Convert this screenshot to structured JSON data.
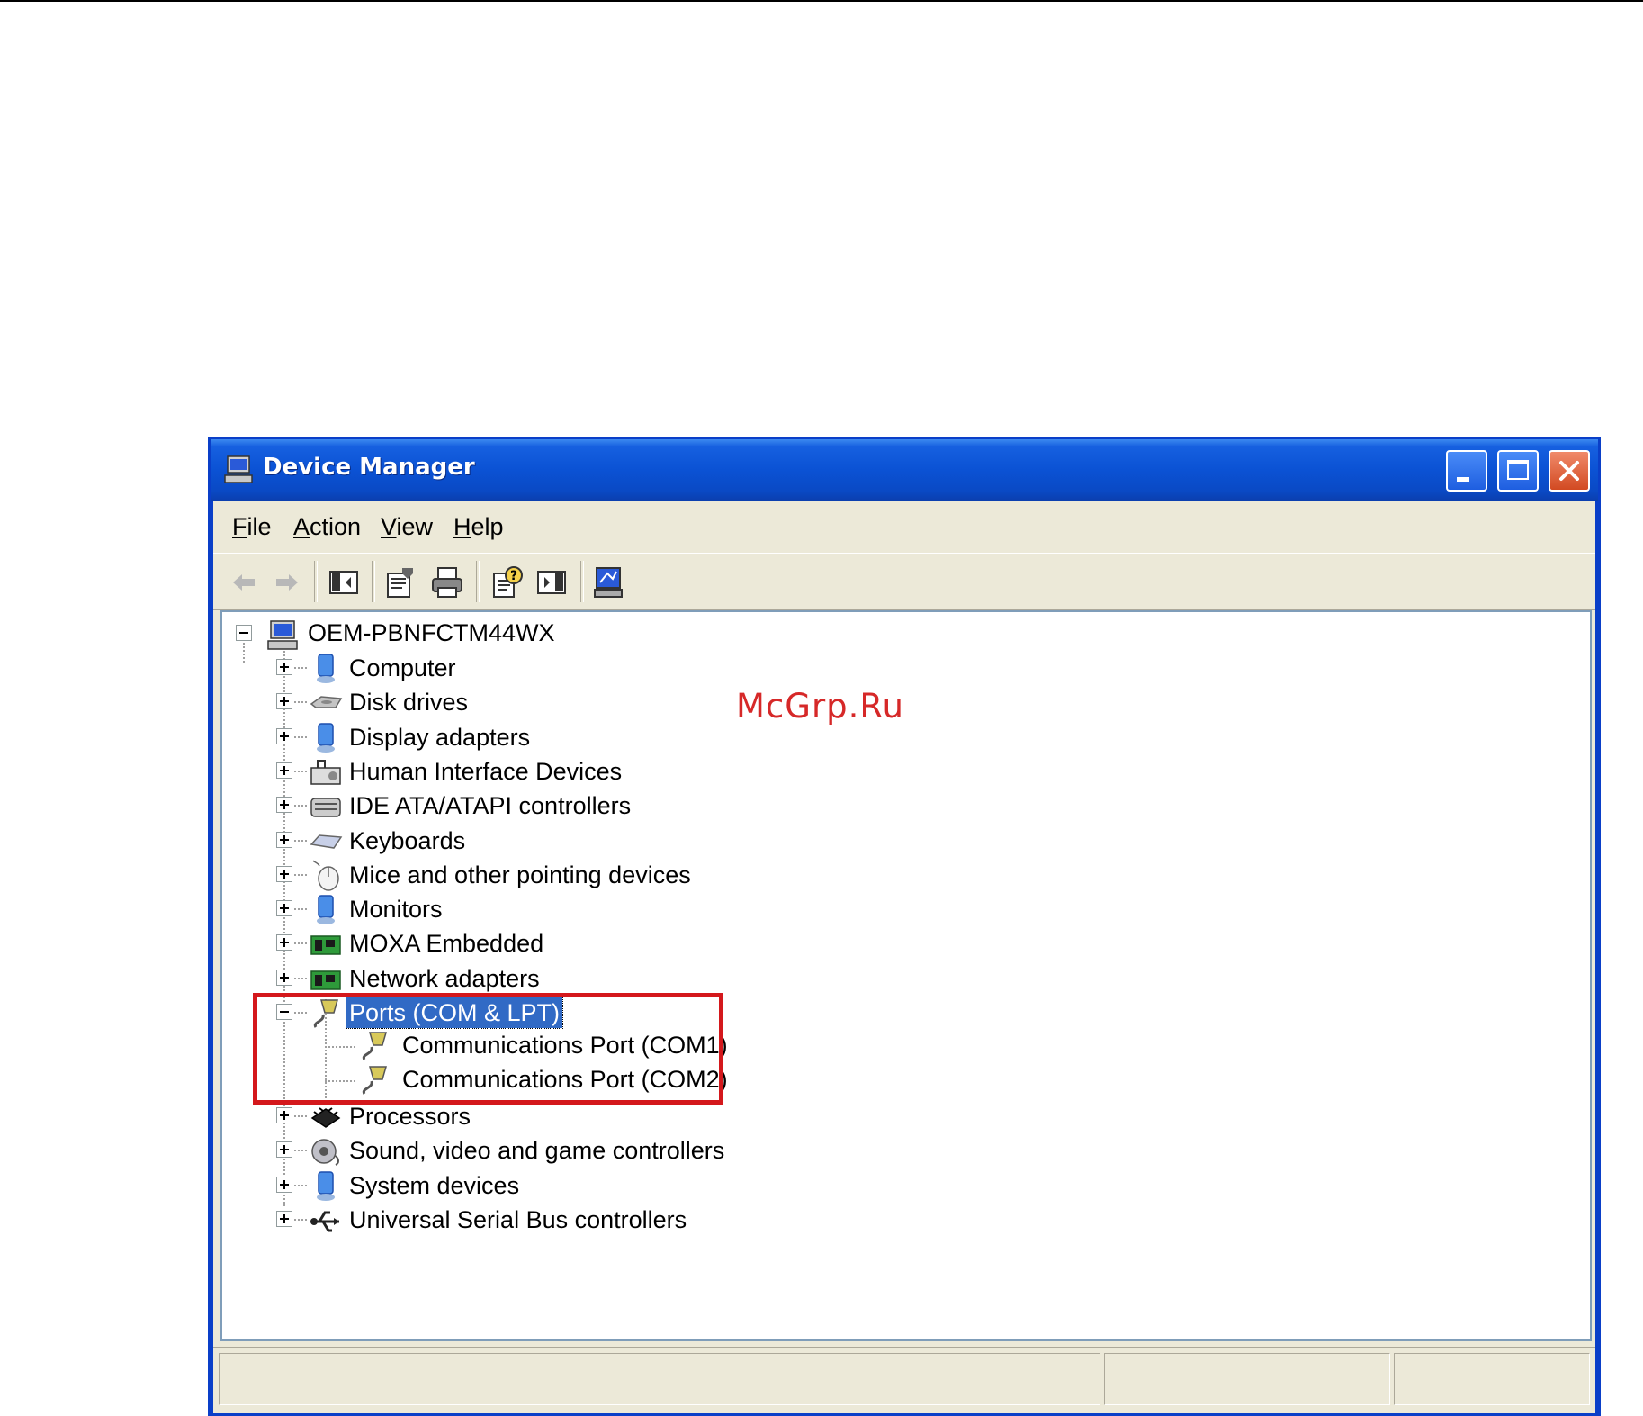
{
  "window": {
    "title": "Device Manager",
    "icon": "computer-icon"
  },
  "menu": [
    "File",
    "Action",
    "View",
    "Help"
  ],
  "toolbar": {
    "buttons": [
      "back-arrow-icon",
      "forward-arrow-icon",
      "show-hide-console-tree-icon",
      "properties-icon",
      "print-icon",
      "help-icon",
      "show-hide-action-pane-icon",
      "scan-hardware-icon"
    ]
  },
  "tree": {
    "root": {
      "label": "OEM-PBNFCTM44WX",
      "icon": "computer-icon"
    },
    "categories": [
      {
        "label": "Computer",
        "icon": "computer-icon"
      },
      {
        "label": "Disk drives",
        "icon": "disk-drive-icon"
      },
      {
        "label": "Display adapters",
        "icon": "display-adapter-icon"
      },
      {
        "label": "Human Interface Devices",
        "icon": "hid-icon"
      },
      {
        "label": "IDE ATA/ATAPI controllers",
        "icon": "ide-controller-icon"
      },
      {
        "label": "Keyboards",
        "icon": "keyboard-icon"
      },
      {
        "label": "Mice and other pointing devices",
        "icon": "mouse-icon"
      },
      {
        "label": "Monitors",
        "icon": "monitor-icon"
      },
      {
        "label": "MOXA Embedded",
        "icon": "board-icon"
      },
      {
        "label": "Network adapters",
        "icon": "network-adapter-icon"
      },
      {
        "label": "Ports (COM & LPT)",
        "icon": "port-icon"
      },
      {
        "label": "Processors",
        "icon": "processor-icon"
      },
      {
        "label": "Sound, video and game controllers",
        "icon": "sound-icon"
      },
      {
        "label": "System devices",
        "icon": "system-device-icon"
      },
      {
        "label": "Universal Serial Bus controllers",
        "icon": "usb-icon"
      }
    ],
    "ports_children": [
      {
        "label": "Communications Port (COM1)",
        "icon": "port-icon"
      },
      {
        "label": "Communications Port (COM2)",
        "icon": "port-icon"
      }
    ]
  },
  "watermark": "McGrp.Ru",
  "colors": {
    "titlebar": "#0a52d4",
    "selection": "#316ac5",
    "highlight_box": "#d4181c",
    "watermark": "#d62828"
  }
}
